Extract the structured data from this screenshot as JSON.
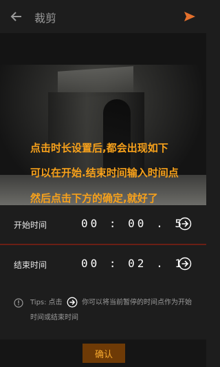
{
  "header": {
    "title": "裁剪",
    "back_icon": "arrow-left-icon",
    "send_icon": "send-icon",
    "accent_color": "#e4702c"
  },
  "video_overlay_caption": [
    "点击时长设置后,都会出现如下",
    "可以在开始.结束时间输入时间点",
    "然后点击下方的确定,就好了"
  ],
  "caption_color": "#f7a11b",
  "trim_panel": {
    "start": {
      "label": "开始时间",
      "value": "00 : 00 . 5"
    },
    "end": {
      "label": "结束时间",
      "value": "00 : 02 . 1"
    },
    "divider_color": "#6b1f14"
  },
  "tips": {
    "prefix": "Tips: 点击",
    "text_after_icon": "你可以将当前暂停的时间点作为开始",
    "line2": "时间或结束时间"
  },
  "confirm_button": {
    "label": "确认",
    "bg_color": "#6e3a06",
    "text_color": "#f6a82e"
  }
}
